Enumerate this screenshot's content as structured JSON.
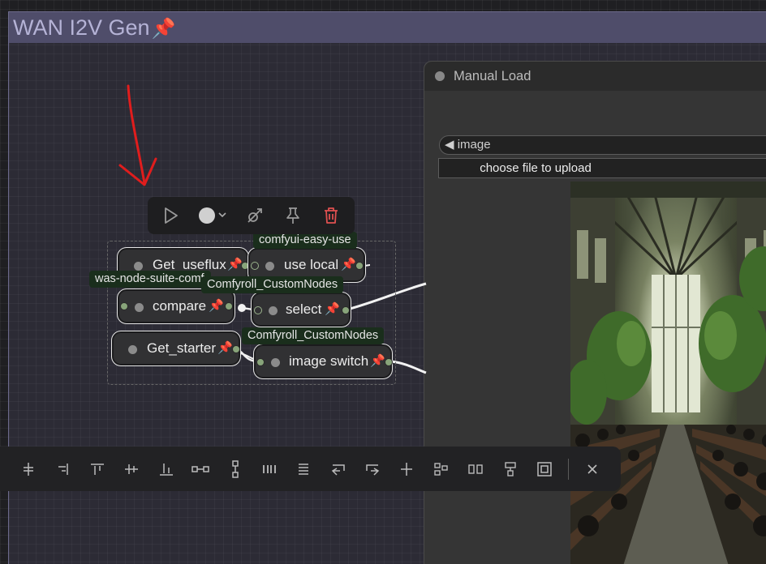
{
  "group": {
    "title": "WAN I2V Gen",
    "pin_icon": "pushpin-icon"
  },
  "node_toolbar": {
    "buttons": [
      {
        "icon": "play-icon"
      },
      {
        "icon": "color-circle-icon",
        "color": "#d0d0d0"
      },
      {
        "icon": "chevron-down-icon"
      },
      {
        "icon": "bypass-icon"
      },
      {
        "icon": "pin-icon"
      },
      {
        "icon": "trash-icon",
        "color": "#e05050"
      }
    ]
  },
  "nodes": {
    "get_useflux": {
      "label": "Get_useflux"
    },
    "use_local": {
      "label": "use local",
      "badge": "comfyui-easy-use"
    },
    "compare": {
      "label": "compare",
      "badge": "was-node-suite-comf"
    },
    "select": {
      "label": "select",
      "badge": "Comfyroll_CustomNodes"
    },
    "get_starter": {
      "label": "Get_starter"
    },
    "image_switch": {
      "label": "image switch",
      "badge": "Comfyroll_CustomNodes"
    }
  },
  "manual_load": {
    "title": "Manual Load",
    "combo_label": "◀ image",
    "upload_label": "choose file to upload"
  },
  "align_toolbar": {
    "icons": [
      "align-left-icon",
      "align-right-icon",
      "align-top-icon",
      "align-center-horizontal-icon",
      "align-bottom-icon",
      "distribute-horizontal-icon",
      "distribute-vertical-icon",
      "columns-icon",
      "rows-icon",
      "arrange-left-icon",
      "arrange-right-icon",
      "center-cross-icon",
      "group-tree-icon",
      "side-by-side-icon",
      "stack-icon",
      "frame-icon"
    ],
    "close_icon": "close-icon"
  },
  "colors": {
    "annotation_arrow": "#e01d1d",
    "pin": "#e03a1a",
    "slot": "#88a47a"
  }
}
